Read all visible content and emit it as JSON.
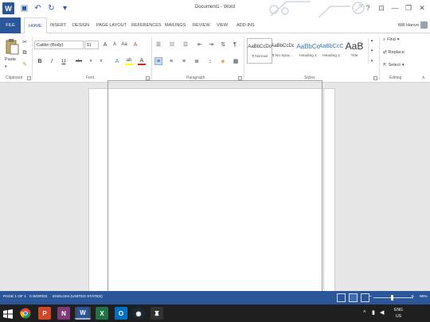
{
  "window": {
    "title": "Document1 - Word",
    "user": "Will Hanvo",
    "help": "?",
    "minimize": "—",
    "restore": "❐",
    "close": "✕"
  },
  "tabs": [
    "FILE",
    "HOME",
    "INSERT",
    "DESIGN",
    "PAGE LAYOUT",
    "REFERENCES",
    "MAILINGS",
    "REVIEW",
    "VIEW",
    "ADD-INS"
  ],
  "ribbon": {
    "clipboard": {
      "paste": "Paste",
      "label": "Clipboard"
    },
    "font": {
      "family": "Calibri (Body)",
      "size": "11",
      "label": "Font",
      "grow": "A",
      "shrink": "A",
      "case": "Aa",
      "clear": "A",
      "bold": "B",
      "italic": "I",
      "underline": "U",
      "strike": "abc",
      "sub": "x",
      "sup": "x",
      "effects": "A",
      "highlight": "ab",
      "color": "A"
    },
    "paragraph": {
      "label": "Paragraph",
      "pilcrow": "¶"
    },
    "styles": {
      "label": "Styles",
      "items": [
        {
          "preview": "AaBbCcDc",
          "name": "¶ Normal"
        },
        {
          "preview": "AaBbCcDc",
          "name": "¶ No Spac..."
        },
        {
          "preview": "AaBbCc",
          "name": "Heading 1"
        },
        {
          "preview": "AaBbCcC",
          "name": "Heading 2"
        },
        {
          "preview": "AaB",
          "name": "Title"
        }
      ]
    },
    "editing": {
      "label": "Editing",
      "find": "Find",
      "replace": "Replace",
      "select": "Select"
    }
  },
  "status": {
    "page": "PAGE 1 OF 1",
    "words": "0 WORDS",
    "language": "ENGLISH (UNITED STATES)",
    "zoom": "90%",
    "minus": "−",
    "plus": "+"
  },
  "taskbar": {
    "apps": [
      "Chrome",
      "PowerPoint",
      "OneNote",
      "Word",
      "Excel",
      "Outlook",
      "Steam",
      "Other"
    ],
    "lang": "ENG",
    "region": "US"
  },
  "colors": {
    "accent": "#2b579a",
    "taskbar": "#1f1f1f"
  }
}
